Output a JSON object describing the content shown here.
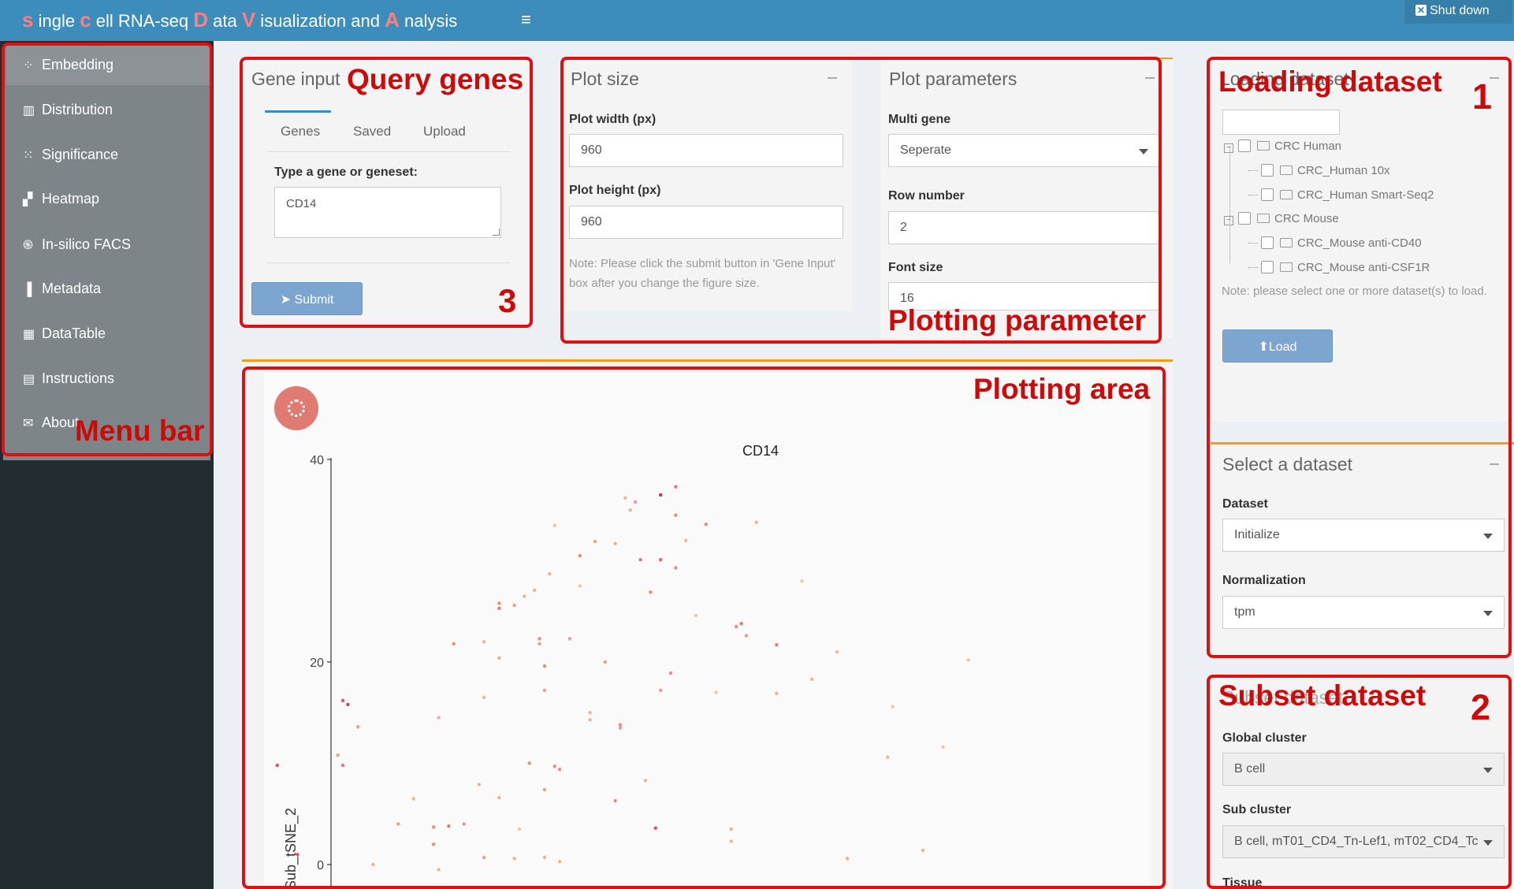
{
  "header": {
    "brand": [
      {
        "accent": "s",
        "rest": " ingle "
      },
      {
        "accent": "c",
        "rest": " ell RNA-seq "
      },
      {
        "accent": "D",
        "rest": " ata "
      },
      {
        "accent": "V",
        "rest": " isualization and "
      },
      {
        "accent": "A",
        "rest": " nalysis"
      }
    ],
    "menu_icon": "≡",
    "shutdown_label": "Shut down"
  },
  "sidebar": {
    "items": [
      {
        "icon": "spinner-icon",
        "glyph": "⁘",
        "label": "Embedding"
      },
      {
        "icon": "bar-chart-icon",
        "glyph": "▥",
        "label": "Distribution"
      },
      {
        "icon": "dots-grid-icon",
        "glyph": "⁙",
        "label": "Significance"
      },
      {
        "icon": "heatmap-icon",
        "glyph": "▞",
        "label": "Heatmap"
      },
      {
        "icon": "fingerprint-icon",
        "glyph": "֍",
        "label": "In-silico FACS"
      },
      {
        "icon": "column-chart-icon",
        "glyph": "▐",
        "label": "Metadata"
      },
      {
        "icon": "table-icon",
        "glyph": "▦",
        "label": "DataTable"
      },
      {
        "icon": "file-icon",
        "glyph": "▤",
        "label": "Instructions"
      },
      {
        "icon": "envelope-icon",
        "glyph": "✉",
        "label": "About"
      }
    ]
  },
  "gene_input": {
    "title": "Gene input",
    "tabs": [
      "Genes",
      "Saved",
      "Upload"
    ],
    "field_label": "Type a gene or geneset:",
    "field_value": "CD14",
    "submit_label": "Submit"
  },
  "plot_size": {
    "title": "Plot size",
    "width_label": "Plot width (px)",
    "width_value": "960",
    "height_label": "Plot height (px)",
    "height_value": "960",
    "note": "Note: Please click the submit button in 'Gene Input' box after you change the figure size."
  },
  "plot_params": {
    "title": "Plot parameters",
    "multi_gene_label": "Multi gene",
    "multi_gene_value": "Seperate",
    "row_number_label": "Row number",
    "row_number_value": "2",
    "font_size_label": "Font size",
    "font_size_value": "16"
  },
  "loading": {
    "title": "Loading dataset",
    "search_value": "",
    "tree": [
      {
        "label": "CRC Human",
        "level": 0,
        "expand": "−"
      },
      {
        "label": "CRC_Human 10x",
        "level": 1
      },
      {
        "label": "CRC_Human Smart-Seq2",
        "level": 1
      },
      {
        "label": "CRC Mouse",
        "level": 0,
        "expand": "−"
      },
      {
        "label": "CRC_Mouse anti-CD40",
        "level": 1
      },
      {
        "label": "CRC_Mouse anti-CSF1R",
        "level": 1
      }
    ],
    "note": "Note: please select one or more dataset(s) to load.",
    "load_label": "Load"
  },
  "select_dataset": {
    "title": "Select a dataset",
    "dataset_label": "Dataset",
    "dataset_value": "Initialize",
    "normalization_label": "Normalization",
    "normalization_value": "tpm"
  },
  "subset": {
    "title": "Subset dataset",
    "global_label": "Global cluster",
    "global_value": "B cell",
    "sub_label": "Sub cluster",
    "sub_value": "B cell, mT01_CD4_Tn-Lef1, mT02_CD4_Tc",
    "tissue_label": "Tissue"
  },
  "annotations": {
    "query_genes": "Query genes",
    "num_3": "3",
    "plotting_parameter": "Plotting parameter",
    "loading_dataset": "Loading dataset",
    "num_1": "1",
    "subset_dataset": "Subset dataset",
    "num_2": "2",
    "plotting_area": "Plotting area",
    "menu_bar": "Menu bar"
  },
  "colors": {
    "header": "#3c8dbc",
    "sidebar": "#222d32",
    "annotation": "#dd1111",
    "box_top_border": "#f39c12",
    "spinner": "#e07b72"
  },
  "chart_data": {
    "type": "scatter",
    "title": "CD14",
    "ylabel": "Sub_tSNE_2",
    "xlabel": "",
    "ylim": [
      0,
      40
    ],
    "yticks": [
      0,
      20,
      40
    ],
    "points": [
      {
        "x": -12,
        "y": 36.5,
        "c": 1.0
      },
      {
        "x": -9,
        "y": 37.3,
        "c": 0.6
      },
      {
        "x": -17,
        "y": 35.8,
        "c": 0.4
      },
      {
        "x": -19,
        "y": 36.2,
        "c": 0.3
      },
      {
        "x": -9,
        "y": 34.5,
        "c": 0.5
      },
      {
        "x": -3,
        "y": 33.6,
        "c": 0.5
      },
      {
        "x": 7,
        "y": 33.8,
        "c": 0.3
      },
      {
        "x": -25,
        "y": 31.9,
        "c": 0.4
      },
      {
        "x": -21,
        "y": 31.7,
        "c": 0.3
      },
      {
        "x": -7,
        "y": 32.0,
        "c": 0.3
      },
      {
        "x": -28,
        "y": 30.5,
        "c": 0.5
      },
      {
        "x": -16,
        "y": 30.1,
        "c": 0.6
      },
      {
        "x": -12,
        "y": 30.1,
        "c": 0.7
      },
      {
        "x": -9,
        "y": 29.3,
        "c": 0.5
      },
      {
        "x": -34,
        "y": 28.7,
        "c": 0.3
      },
      {
        "x": -39,
        "y": 26.5,
        "c": 0.3
      },
      {
        "x": -44,
        "y": 25.8,
        "c": 0.5
      },
      {
        "x": -44,
        "y": 25.3,
        "c": 0.6
      },
      {
        "x": -41,
        "y": 25.6,
        "c": 0.4
      },
      {
        "x": -37,
        "y": 27.1,
        "c": 0.3
      },
      {
        "x": -14,
        "y": 26.9,
        "c": 0.5
      },
      {
        "x": 3,
        "y": 23.5,
        "c": 0.5
      },
      {
        "x": 4,
        "y": 23.8,
        "c": 0.6
      },
      {
        "x": 5,
        "y": 22.6,
        "c": 0.4
      },
      {
        "x": -30,
        "y": 22.3,
        "c": 0.4
      },
      {
        "x": -36,
        "y": 22.3,
        "c": 0.5
      },
      {
        "x": -36,
        "y": 21.8,
        "c": 0.4
      },
      {
        "x": -53,
        "y": 21.8,
        "c": 0.5
      },
      {
        "x": -47,
        "y": 22.0,
        "c": 0.3
      },
      {
        "x": -44,
        "y": 20.4,
        "c": 0.3
      },
      {
        "x": -35,
        "y": 19.6,
        "c": 0.5
      },
      {
        "x": -23,
        "y": 20.0,
        "c": 0.4
      },
      {
        "x": -10,
        "y": 18.9,
        "c": 0.5
      },
      {
        "x": -12,
        "y": 17.2,
        "c": 0.4
      },
      {
        "x": 11,
        "y": 21.7,
        "c": 0.6
      },
      {
        "x": 18,
        "y": 18.3,
        "c": 0.3
      },
      {
        "x": 23,
        "y": 21.0,
        "c": 0.3
      },
      {
        "x": 11,
        "y": 16.9,
        "c": 0.3
      },
      {
        "x": -35,
        "y": 17.2,
        "c": 0.4
      },
      {
        "x": -47,
        "y": 16.5,
        "c": 0.3
      },
      {
        "x": -56,
        "y": 14.5,
        "c": 0.3
      },
      {
        "x": -75,
        "y": 16.2,
        "c": 0.8
      },
      {
        "x": -74,
        "y": 15.8,
        "c": 0.9
      },
      {
        "x": -72,
        "y": 13.6,
        "c": 0.4
      },
      {
        "x": -26,
        "y": 15.0,
        "c": 0.3
      },
      {
        "x": -26,
        "y": 14.3,
        "c": 0.3
      },
      {
        "x": -20,
        "y": 13.8,
        "c": 0.5
      },
      {
        "x": -20,
        "y": 13.5,
        "c": 0.4
      },
      {
        "x": -88,
        "y": 9.8,
        "c": 0.8
      },
      {
        "x": -76,
        "y": 10.8,
        "c": 0.4
      },
      {
        "x": -75,
        "y": 9.8,
        "c": 0.6
      },
      {
        "x": -38,
        "y": 10.0,
        "c": 0.5
      },
      {
        "x": -33,
        "y": 9.7,
        "c": 0.5
      },
      {
        "x": -32,
        "y": 9.4,
        "c": 0.5
      },
      {
        "x": -48,
        "y": 7.9,
        "c": 0.3
      },
      {
        "x": -44,
        "y": 6.6,
        "c": 0.3
      },
      {
        "x": -35,
        "y": 7.4,
        "c": 0.4
      },
      {
        "x": -15,
        "y": 8.3,
        "c": 0.3
      },
      {
        "x": -21,
        "y": 6.3,
        "c": 0.5
      },
      {
        "x": -64,
        "y": 4.0,
        "c": 0.4
      },
      {
        "x": -57,
        "y": 3.7,
        "c": 0.5
      },
      {
        "x": -54,
        "y": 3.8,
        "c": 0.6
      },
      {
        "x": -51,
        "y": 4.0,
        "c": 0.4
      },
      {
        "x": -13,
        "y": 3.6,
        "c": 0.8
      },
      {
        "x": 2,
        "y": 3.5,
        "c": 0.3
      },
      {
        "x": 2,
        "y": 2.3,
        "c": 0.3
      },
      {
        "x": -84,
        "y": 1.0,
        "c": 0.8
      },
      {
        "x": -57,
        "y": 2.0,
        "c": 0.5
      },
      {
        "x": -47,
        "y": 0.7,
        "c": 0.4
      },
      {
        "x": -41,
        "y": 0.6,
        "c": 0.3
      },
      {
        "x": -35,
        "y": 0.7,
        "c": 0.3
      },
      {
        "x": -32,
        "y": 0.3,
        "c": 0.3
      },
      {
        "x": -69,
        "y": 0.0,
        "c": 0.3
      },
      {
        "x": -56,
        "y": -0.5,
        "c": 0.3
      },
      {
        "x": 25,
        "y": 0.6,
        "c": 0.3
      },
      {
        "x": 40,
        "y": 1.4,
        "c": 0.3
      },
      {
        "x": 33,
        "y": 10.6,
        "c": 0.3
      },
      {
        "x": 44,
        "y": 11.6,
        "c": 0.2
      },
      {
        "x": 49,
        "y": 20.2,
        "c": 0.2
      },
      {
        "x": 34,
        "y": 15.6,
        "c": 0.2
      },
      {
        "x": -1,
        "y": 17.0,
        "c": 0.2
      },
      {
        "x": -5,
        "y": 24.6,
        "c": 0.2
      },
      {
        "x": 16,
        "y": 28.0,
        "c": 0.2
      },
      {
        "x": -18,
        "y": 35.0,
        "c": 0.3
      },
      {
        "x": -33,
        "y": 33.5,
        "c": 0.2
      },
      {
        "x": -28,
        "y": 27.5,
        "c": 0.2
      },
      {
        "x": -61,
        "y": 6.5,
        "c": 0.3
      },
      {
        "x": -40,
        "y": 3.5,
        "c": 0.2
      }
    ]
  }
}
